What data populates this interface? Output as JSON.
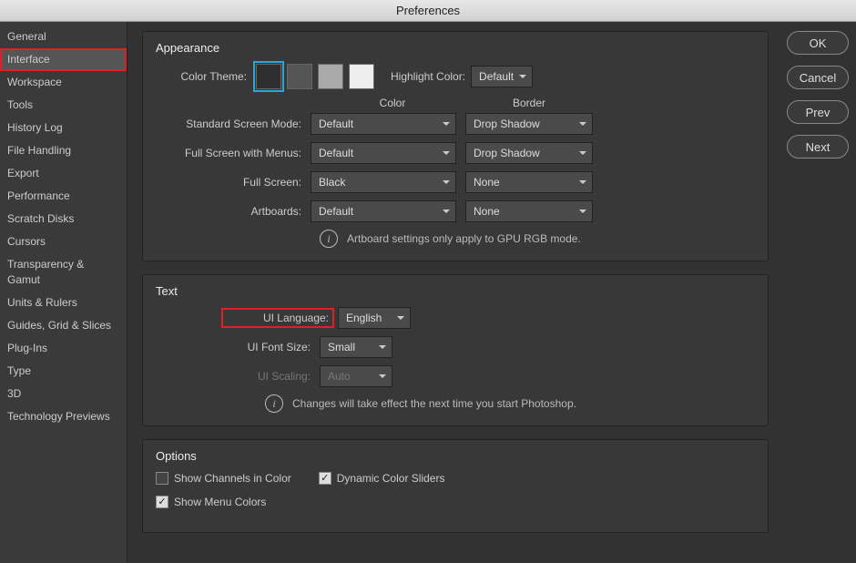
{
  "title": "Preferences",
  "buttons": {
    "ok": "OK",
    "cancel": "Cancel",
    "prev": "Prev",
    "next": "Next"
  },
  "sidebar": {
    "items": [
      "General",
      "Interface",
      "Workspace",
      "Tools",
      "History Log",
      "File Handling",
      "Export",
      "Performance",
      "Scratch Disks",
      "Cursors",
      "Transparency & Gamut",
      "Units & Rulers",
      "Guides, Grid & Slices",
      "Plug-Ins",
      "Type",
      "3D",
      "Technology Previews"
    ],
    "selected": 1
  },
  "appearance": {
    "title": "Appearance",
    "color_theme_label": "Color Theme:",
    "swatches": [
      "#2f2f2f",
      "#555555",
      "#aaaaaa",
      "#ededed"
    ],
    "selected_swatch": 0,
    "highlight_color_label": "Highlight Color:",
    "highlight_color_value": "Default",
    "col_color": "Color",
    "col_border": "Border",
    "rows": [
      {
        "label": "Standard Screen Mode:",
        "color": "Default",
        "border": "Drop Shadow"
      },
      {
        "label": "Full Screen with Menus:",
        "color": "Default",
        "border": "Drop Shadow"
      },
      {
        "label": "Full Screen:",
        "color": "Black",
        "border": "None"
      },
      {
        "label": "Artboards:",
        "color": "Default",
        "border": "None"
      }
    ],
    "info": "Artboard settings only apply to GPU RGB mode."
  },
  "text": {
    "title": "Text",
    "ui_language_label": "UI Language:",
    "ui_language_value": "English",
    "ui_font_size_label": "UI Font Size:",
    "ui_font_size_value": "Small",
    "ui_scaling_label": "UI Scaling:",
    "ui_scaling_value": "Auto",
    "info": "Changes will take effect the next time you start Photoshop."
  },
  "options": {
    "title": "Options",
    "show_channels": {
      "label": "Show Channels in Color",
      "checked": false
    },
    "dynamic_sliders": {
      "label": "Dynamic Color Sliders",
      "checked": true
    },
    "show_menu_colors": {
      "label": "Show Menu Colors",
      "checked": true
    }
  }
}
